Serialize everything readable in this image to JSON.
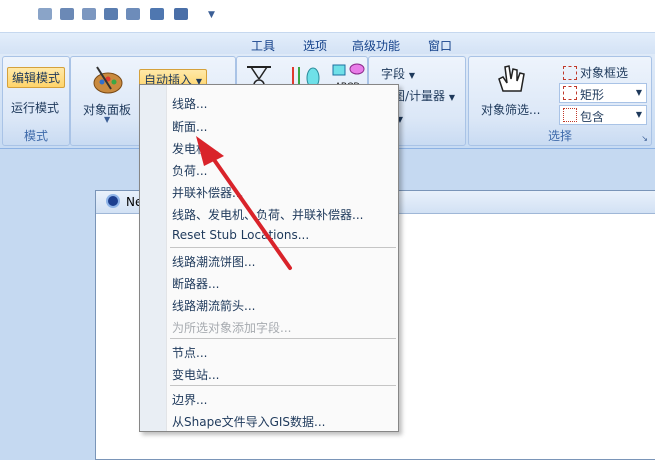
{
  "colors": {
    "ribbon_bg": "#c7dbf3",
    "highlight": "#ffd46a",
    "arrow": "#d9232a",
    "text": "#1e395b"
  },
  "menu_tabs": [
    "工具",
    "选项",
    "高级功能",
    "窗口"
  ],
  "groups": {
    "mode": {
      "edit_mode": "编辑模式",
      "run_mode": "运行模式",
      "label": "模式"
    },
    "object_panel": {
      "label": "对象面板"
    },
    "auto_insert": {
      "label": "自动插入"
    },
    "fields": {
      "field": "字段",
      "chart_meter": "饼图/计量器",
      "show": "示"
    },
    "select": {
      "object_filter": "对象筛选...",
      "object_box_select": "对象框选",
      "rectangle": "矩形",
      "contains": "包含",
      "label": "选择"
    }
  },
  "doc": {
    "title": "Ne"
  },
  "dropdown_items": [
    {
      "label": "线路...",
      "enabled": true
    },
    {
      "label": "断面...",
      "enabled": true
    },
    {
      "label": "发电机...",
      "enabled": true
    },
    {
      "label": "负荷...",
      "enabled": true
    },
    {
      "label": "并联补偿器...",
      "enabled": true
    },
    {
      "label": "线路、发电机、负荷、并联补偿器...",
      "enabled": true
    },
    {
      "label": "Reset Stub Locations...",
      "enabled": true
    },
    {
      "label": "线路潮流饼图...",
      "enabled": true
    },
    {
      "label": "断路器...",
      "enabled": true
    },
    {
      "label": "线路潮流箭头...",
      "enabled": true
    },
    {
      "label": "为所选对象添加字段...",
      "enabled": false
    },
    {
      "label": "节点...",
      "enabled": true
    },
    {
      "label": "变电站...",
      "enabled": true
    },
    {
      "label": "边界...",
      "enabled": true
    },
    {
      "label": "从Shape文件导入GIS数据...",
      "enabled": true
    }
  ],
  "icons": [
    "gear-wrench-icon",
    "object-panel-icon",
    "transformer-icon",
    "shapes-abcd-icon",
    "hand-pointer-icon",
    "dialog-launcher-icon"
  ]
}
